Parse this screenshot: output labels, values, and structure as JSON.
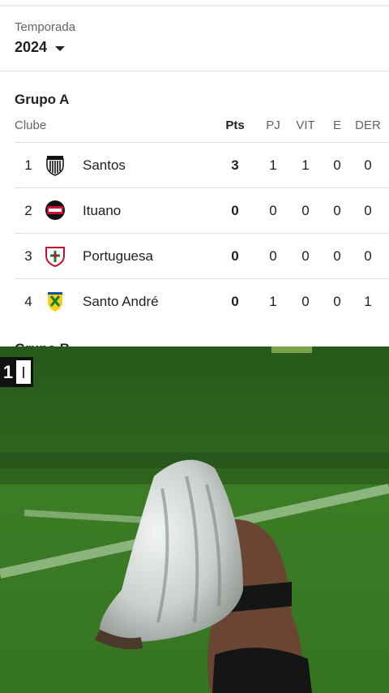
{
  "season": {
    "label": "Temporada",
    "value": "2024"
  },
  "group_a": {
    "title": "Grupo A",
    "headers": {
      "club": "Clube",
      "pts": "Pts",
      "pj": "PJ",
      "vit": "VIT",
      "e": "E",
      "der": "DER"
    },
    "rows": [
      {
        "pos": "1",
        "team": "Santos",
        "crest": "santos-crest",
        "pts": "3",
        "pj": "1",
        "vit": "1",
        "e": "0",
        "der": "0"
      },
      {
        "pos": "2",
        "team": "Ituano",
        "crest": "ituano-crest",
        "pts": "0",
        "pj": "0",
        "vit": "0",
        "e": "0",
        "der": "0"
      },
      {
        "pos": "3",
        "team": "Portuguesa",
        "crest": "portuguesa-crest",
        "pts": "0",
        "pj": "0",
        "vit": "0",
        "e": "0",
        "der": "0"
      },
      {
        "pos": "4",
        "team": "Santo André",
        "crest": "santo-andre-crest",
        "pts": "0",
        "pj": "1",
        "vit": "0",
        "e": "0",
        "der": "1"
      }
    ]
  },
  "group_b": {
    "title": "Grupo B"
  },
  "video": {
    "scoreboard": "1"
  },
  "colors": {
    "pitch": "#2f6a1f",
    "text": "#202124",
    "muted": "#5f6368",
    "divider": "#dadce0"
  }
}
